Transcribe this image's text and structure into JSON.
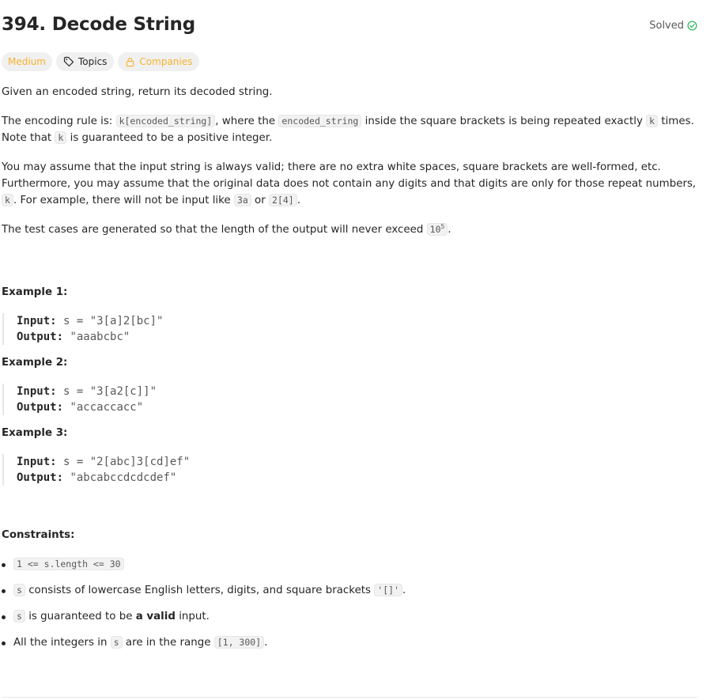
{
  "problem": {
    "title": "394. Decode String",
    "status": "Solved",
    "difficulty": "Medium",
    "topics_label": "Topics",
    "companies_label": "Companies"
  },
  "description": {
    "p1": "Given an encoded string, return its decoded string.",
    "p2": {
      "t1": "The encoding rule is: ",
      "c1": "k[encoded_string]",
      "t2": ", where the ",
      "c2": "encoded_string",
      "t3": " inside the square brackets is being repeated exactly ",
      "c3": "k",
      "t4": " times. Note that ",
      "c4": "k",
      "t5": " is guaranteed to be a positive integer."
    },
    "p3": {
      "t1": "You may assume that the input string is always valid; there are no extra white spaces, square brackets are well-formed, etc. Furthermore, you may assume that the original data does not contain any digits and that digits are only for those repeat numbers, ",
      "c1": "k",
      "t2": ". For example, there will not be input like ",
      "c2": "3a",
      "t3": " or ",
      "c3": "2[4]",
      "t4": "."
    },
    "p4": {
      "t1": "The test cases are generated so that the length of the output will never exceed ",
      "c1_base": "10",
      "c1_exp": "5",
      "t2": "."
    }
  },
  "examples": [
    {
      "title": "Example 1:",
      "input_label": "Input:",
      "input": "s = \"3[a]2[bc]\"",
      "output_label": "Output:",
      "output": "\"aaabcbc\""
    },
    {
      "title": "Example 2:",
      "input_label": "Input:",
      "input": "s = \"3[a2[c]]\"",
      "output_label": "Output:",
      "output": "\"accaccacc\""
    },
    {
      "title": "Example 3:",
      "input_label": "Input:",
      "input": "s = \"2[abc]3[cd]ef\"",
      "output_label": "Output:",
      "output": "\"abcabccdcdcdef\""
    }
  ],
  "constraints": {
    "title": "Constraints:",
    "c1": {
      "code": "1 <= s.length <= 30"
    },
    "c2": {
      "code1": "s",
      "t1": " consists of lowercase English letters, digits, and square brackets ",
      "code2": "'[]'",
      "t2": "."
    },
    "c3": {
      "code1": "s",
      "t1": " is guaranteed to be ",
      "bold": "a valid",
      "t2": " input."
    },
    "c4": {
      "t1": "All the integers in ",
      "code1": "s",
      "t2": " are in the range ",
      "code2": "[1, 300]",
      "t3": "."
    }
  },
  "colors": {
    "difficulty": "#f5b32d",
    "solved_check": "#2cbb5d",
    "text": "#262626",
    "muted": "#595959",
    "chip_bg": "#f0f0f0"
  }
}
